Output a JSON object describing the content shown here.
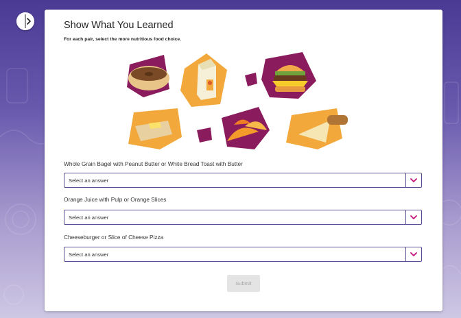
{
  "colors": {
    "accent": "#c4147a",
    "select_border": "#5a4d92",
    "shape_magenta": "#8a1b5c",
    "shape_orange": "#f3a83c",
    "background_top": "#4a3a94"
  },
  "card": {
    "title": "Show What You Learned",
    "instruction": "For each pair, select the more nutritious food choice."
  },
  "sidebar_toggle": {
    "icon": "chevron-right-icon"
  },
  "questions": [
    {
      "label": "Whole Grain Bagel with Peanut Butter or White Bread Toast with Butter",
      "selected": "Select an answer"
    },
    {
      "label": "Orange Juice with Pulp or Orange Slices",
      "selected": "Select an answer"
    },
    {
      "label": "Cheeseburger or Slice of Cheese Pizza",
      "selected": "Select an answer"
    }
  ],
  "submit_label": "Submit"
}
